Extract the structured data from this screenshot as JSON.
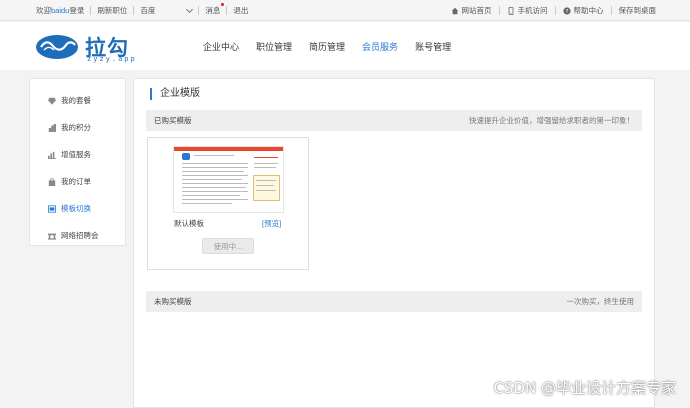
{
  "topbar": {
    "welcome": "欢迎",
    "username": "baidu",
    "login": "登录",
    "refresh_jobs": "刷新职位",
    "select_value": "百度",
    "messages": "消息",
    "logout": "退出",
    "site_home": "网站首页",
    "mobile": "手机访问",
    "help": "帮助中心",
    "save_desktop": "保存到桌面"
  },
  "header": {
    "logo_main": "拉勾",
    "logo_sub": "zyzy.app",
    "nav": [
      "企业中心",
      "职位管理",
      "简历管理",
      "会员服务",
      "账号管理"
    ],
    "active_nav": "会员服务"
  },
  "sidebar": {
    "items": [
      {
        "label": "我的套餐",
        "icon": "diamond-icon"
      },
      {
        "label": "我的积分",
        "icon": "coins-icon"
      },
      {
        "label": "增值服务",
        "icon": "bar-chart-icon"
      },
      {
        "label": "我的订单",
        "icon": "bag-icon"
      },
      {
        "label": "模板切换",
        "icon": "template-icon"
      },
      {
        "label": "网络招聘会",
        "icon": "network-icon"
      }
    ],
    "active": "模板切换"
  },
  "main": {
    "title": "企业模版",
    "purchased": {
      "label": "已购买模版",
      "hint": "快速提升企业价值，增强留给求职者的第一印象！"
    },
    "template": {
      "name": "默认模板",
      "preview": "[预览]",
      "button": "使用中..."
    },
    "not_purchased": {
      "label": "未购买模版",
      "hint": "一次购买，终生使用"
    }
  },
  "watermark": "CSDN @毕业设计方案专家",
  "colors": {
    "accent": "#2a7ad0",
    "thumb_bar": "#e8472b"
  }
}
